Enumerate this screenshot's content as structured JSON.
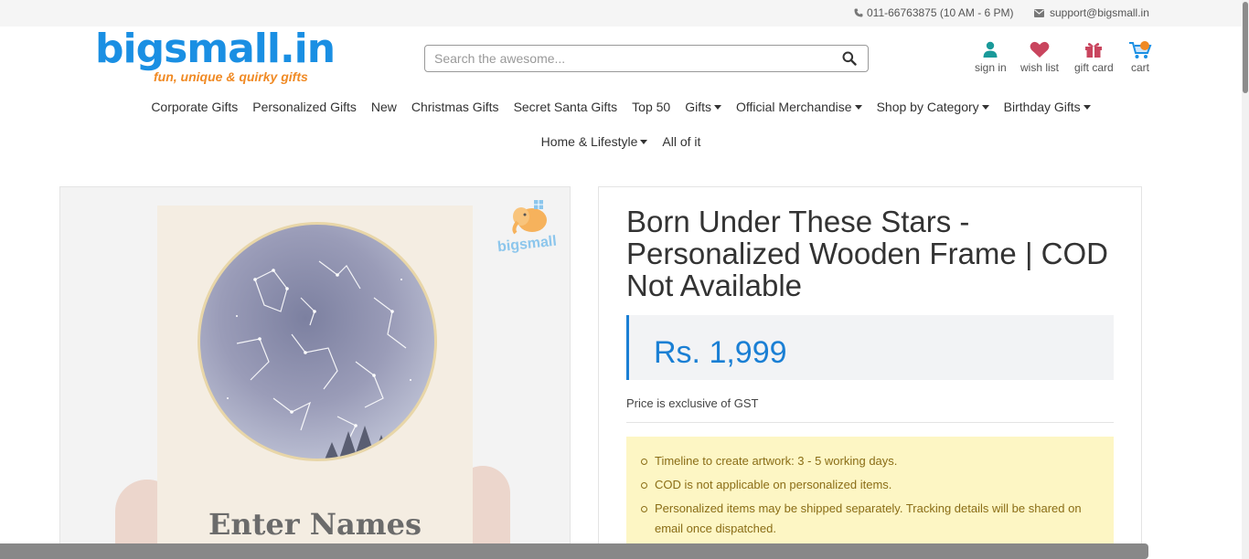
{
  "topbar": {
    "phone": "011-66763875 (10 AM - 6 PM)",
    "email": "support@bigsmall.in",
    "phone_icon": "phone-icon",
    "email_icon": "envelope-icon"
  },
  "logo": {
    "wordmark": "bigsmall.in",
    "tagline": "fun, unique & quirky gifts"
  },
  "search": {
    "placeholder": "Search the awesome...",
    "value": "",
    "icon": "search-icon"
  },
  "account_links": [
    {
      "label": "sign in",
      "icon": "user-icon"
    },
    {
      "label": "wish list",
      "icon": "heart-icon"
    },
    {
      "label": "gift card",
      "icon": "gift-icon"
    },
    {
      "label": "cart",
      "icon": "cart-icon"
    }
  ],
  "nav": {
    "row1": [
      {
        "label": "Corporate Gifts"
      },
      {
        "label": "Personalized Gifts"
      },
      {
        "label": "New"
      },
      {
        "label": "Christmas Gifts"
      },
      {
        "label": "Secret Santa Gifts"
      },
      {
        "label": "Top 50"
      },
      {
        "label": "Gifts",
        "dropdown": true
      },
      {
        "label": "Official Merchandise",
        "dropdown": true
      },
      {
        "label": "Shop by Category",
        "dropdown": true
      },
      {
        "label": "Birthday Gifts",
        "dropdown": true
      }
    ],
    "row2": [
      {
        "label": "Home & Lifestyle",
        "dropdown": true
      },
      {
        "label": "All of it"
      }
    ]
  },
  "product_image": {
    "overlay_text": "Enter Names",
    "watermark": "bigsmall"
  },
  "product": {
    "title": "Born Under These Stars - Personalized Wooden Frame | COD Not Available",
    "price": "Rs. 1,999",
    "gst_note": "Price is exclusive of GST",
    "notes": [
      "Timeline to create artwork: 3 - 5 working days.",
      "COD is not applicable on personalized items.",
      "Personalized items may be shipped separately. Tracking details will be shared on email once dispatched."
    ]
  },
  "colors": {
    "brand_blue": "#1a8fe3",
    "brand_orange": "#f08a24",
    "price_blue": "#1a7fd4",
    "note_bg": "#fdf6c4",
    "note_text": "#8a6d16",
    "user_icon": "#1a9a9a",
    "heart_icon": "#c9455e",
    "gift_icon": "#c9455e"
  }
}
